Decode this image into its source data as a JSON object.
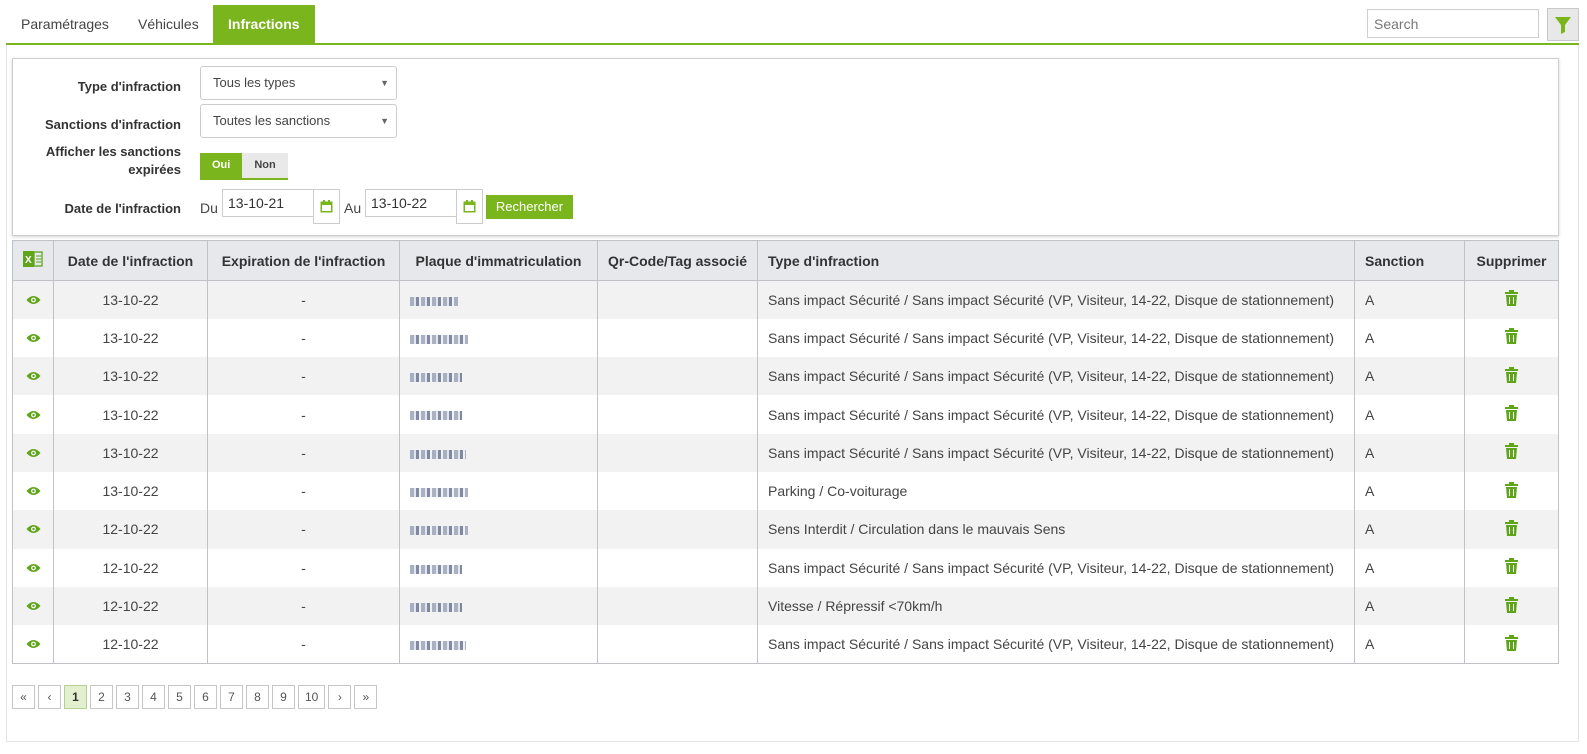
{
  "tabs": [
    {
      "label": "Paramétrages",
      "active": false
    },
    {
      "label": "Véhicules",
      "active": false
    },
    {
      "label": "Infractions",
      "active": true
    }
  ],
  "search": {
    "placeholder": "Search",
    "value": ""
  },
  "filters": {
    "type_label": "Type d'infraction",
    "type_value": "Tous les types",
    "sanction_label": "Sanctions d'infraction",
    "sanction_value": "Toutes les sanctions",
    "expired_label_line1": "Afficher les sanctions",
    "expired_label_line2": "expirées",
    "toggle_yes": "Oui",
    "toggle_no": "Non",
    "date_label": "Date de l'infraction",
    "from_label": "Du",
    "from_value": "13-10-21",
    "to_label": "Au",
    "to_value": "13-10-22",
    "search_button": "Rechercher"
  },
  "table": {
    "headers": [
      "",
      "Date de l'infraction",
      "Expiration de l'infraction",
      "Plaque d'immatriculation",
      "Qr-Code/Tag associé",
      "Type d'infraction",
      "Sanction",
      "Supprimer"
    ],
    "rows": [
      {
        "date": "13-10-22",
        "expiration": "-",
        "qr": "",
        "type": "Sans impact Sécurité / Sans impact Sécurité (VP, Visiteur, 14-22, Disque de stationnement)",
        "sanction": "A"
      },
      {
        "date": "13-10-22",
        "expiration": "-",
        "qr": "",
        "type": "Sans impact Sécurité / Sans impact Sécurité (VP, Visiteur, 14-22, Disque de stationnement)",
        "sanction": "A"
      },
      {
        "date": "13-10-22",
        "expiration": "-",
        "qr": "",
        "type": "Sans impact Sécurité / Sans impact Sécurité (VP, Visiteur, 14-22, Disque de stationnement)",
        "sanction": "A"
      },
      {
        "date": "13-10-22",
        "expiration": "-",
        "qr": "",
        "type": "Sans impact Sécurité / Sans impact Sécurité (VP, Visiteur, 14-22, Disque de stationnement)",
        "sanction": "A"
      },
      {
        "date": "13-10-22",
        "expiration": "-",
        "qr": "",
        "type": "Sans impact Sécurité / Sans impact Sécurité (VP, Visiteur, 14-22, Disque de stationnement)",
        "sanction": "A"
      },
      {
        "date": "13-10-22",
        "expiration": "-",
        "qr": "",
        "type": "Parking / Co-voiturage",
        "sanction": "A"
      },
      {
        "date": "12-10-22",
        "expiration": "-",
        "qr": "",
        "type": "Sens Interdit / Circulation dans le mauvais Sens",
        "sanction": "A"
      },
      {
        "date": "12-10-22",
        "expiration": "-",
        "qr": "",
        "type": "Sans impact Sécurité / Sans impact Sécurité (VP, Visiteur, 14-22, Disque de stationnement)",
        "sanction": "A"
      },
      {
        "date": "12-10-22",
        "expiration": "-",
        "qr": "",
        "type": "Vitesse / Répressif <70km/h",
        "sanction": "A"
      },
      {
        "date": "12-10-22",
        "expiration": "-",
        "qr": "",
        "type": "Sans impact Sécurité / Sans impact Sécurité (VP, Visiteur, 14-22, Disque de stationnement)",
        "sanction": "A"
      }
    ]
  },
  "pagination": {
    "items": [
      "«",
      "‹",
      "1",
      "2",
      "3",
      "4",
      "5",
      "6",
      "7",
      "8",
      "9",
      "10",
      "›",
      "»"
    ],
    "active": "1"
  },
  "icons": {
    "excel": "excel-icon",
    "view": "eye-icon",
    "delete": "trash-icon",
    "calendar": "calendar-icon",
    "filter": "funnel-icon"
  },
  "colors": {
    "accent": "#7ab51d",
    "header_bg": "#e6e8ec",
    "row_alt": "#f2f2f2"
  }
}
